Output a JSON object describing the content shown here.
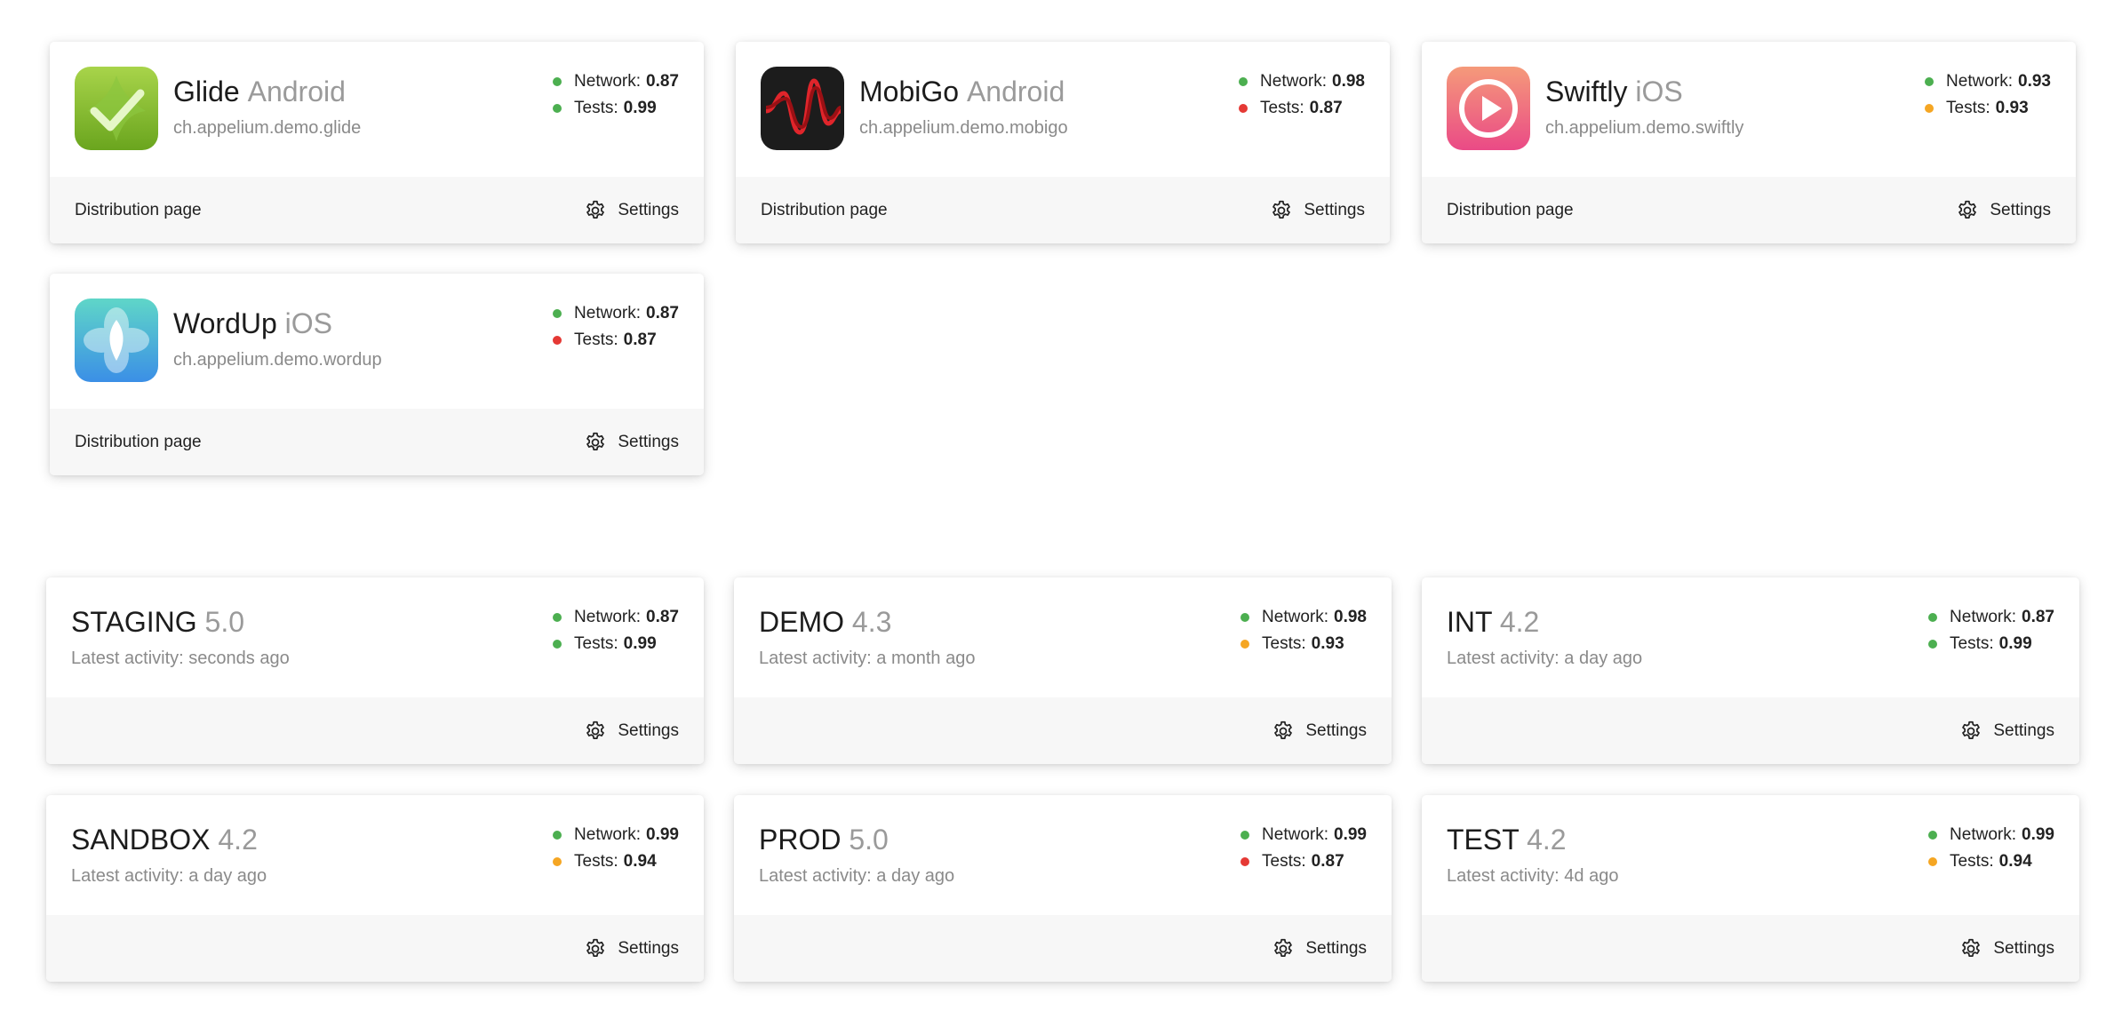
{
  "colors": {
    "green": "#4caf50",
    "red": "#e53935",
    "orange": "#f5a623"
  },
  "apps": [
    {
      "name": "Glide",
      "platform": "Android",
      "package": "ch.appelium.demo.glide",
      "icon": "glide-checkmark-icon",
      "network_label": "Network:",
      "network_value": "0.87",
      "network_status": "green",
      "tests_label": "Tests:",
      "tests_value": "0.99",
      "tests_status": "green",
      "distribution_label": "Distribution page",
      "settings_label": "Settings"
    },
    {
      "name": "MobiGo",
      "platform": "Android",
      "package": "ch.appelium.demo.mobigo",
      "icon": "mobigo-wave-icon",
      "network_label": "Network:",
      "network_value": "0.98",
      "network_status": "green",
      "tests_label": "Tests:",
      "tests_value": "0.87",
      "tests_status": "red",
      "distribution_label": "Distribution page",
      "settings_label": "Settings"
    },
    {
      "name": "Swiftly",
      "platform": "iOS",
      "package": "ch.appelium.demo.swiftly",
      "icon": "swiftly-play-icon",
      "network_label": "Network:",
      "network_value": "0.93",
      "network_status": "green",
      "tests_label": "Tests:",
      "tests_value": "0.93",
      "tests_status": "orange",
      "distribution_label": "Distribution page",
      "settings_label": "Settings"
    },
    {
      "name": "WordUp",
      "platform": "iOS",
      "package": "ch.appelium.demo.wordup",
      "icon": "wordup-flower-icon",
      "network_label": "Network:",
      "network_value": "0.87",
      "network_status": "green",
      "tests_label": "Tests:",
      "tests_value": "0.87",
      "tests_status": "red",
      "distribution_label": "Distribution page",
      "settings_label": "Settings"
    }
  ],
  "environments": [
    {
      "name": "STAGING",
      "version": "5.0",
      "activity": "Latest activity: seconds ago",
      "network_label": "Network:",
      "network_value": "0.87",
      "network_status": "green",
      "tests_label": "Tests:",
      "tests_value": "0.99",
      "tests_status": "green",
      "settings_label": "Settings"
    },
    {
      "name": "DEMO",
      "version": "4.3",
      "activity": "Latest activity: a month ago",
      "network_label": "Network:",
      "network_value": "0.98",
      "network_status": "green",
      "tests_label": "Tests:",
      "tests_value": "0.93",
      "tests_status": "orange",
      "settings_label": "Settings"
    },
    {
      "name": "INT",
      "version": "4.2",
      "activity": "Latest activity: a day ago",
      "network_label": "Network:",
      "network_value": "0.87",
      "network_status": "green",
      "tests_label": "Tests:",
      "tests_value": "0.99",
      "tests_status": "green",
      "settings_label": "Settings"
    },
    {
      "name": "SANDBOX",
      "version": "4.2",
      "activity": "Latest activity: a day ago",
      "network_label": "Network:",
      "network_value": "0.99",
      "network_status": "green",
      "tests_label": "Tests:",
      "tests_value": "0.94",
      "tests_status": "orange",
      "settings_label": "Settings"
    },
    {
      "name": "PROD",
      "version": "5.0",
      "activity": "Latest activity: a day ago",
      "network_label": "Network:",
      "network_value": "0.99",
      "network_status": "green",
      "tests_label": "Tests:",
      "tests_value": "0.87",
      "tests_status": "red",
      "settings_label": "Settings"
    },
    {
      "name": "TEST",
      "version": "4.2",
      "activity": "Latest activity: 4d ago",
      "network_label": "Network:",
      "network_value": "0.99",
      "network_status": "green",
      "tests_label": "Tests:",
      "tests_value": "0.94",
      "tests_status": "orange",
      "settings_label": "Settings"
    }
  ]
}
